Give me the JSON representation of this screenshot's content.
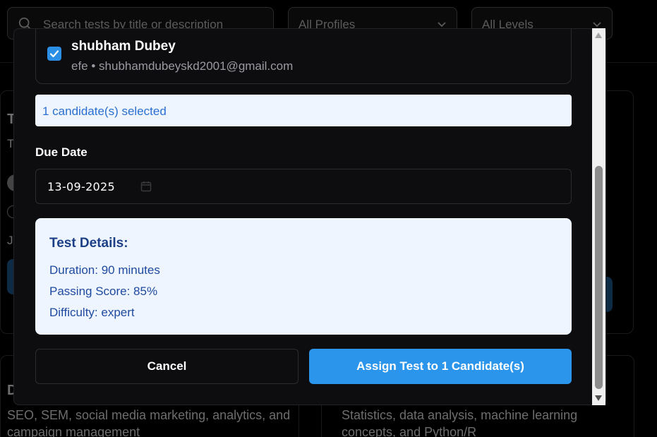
{
  "background": {
    "search_placeholder": "Search tests by title or description",
    "profile_filter": "All Profiles",
    "level_filter": "All Levels",
    "card_left_desc_line1": "SEO, SEM, social media marketing, analytics, and",
    "card_left_desc_line2": "campaign management",
    "card_right_desc_line1": "Statistics, data analysis, machine learning",
    "card_right_desc_line2": "concepts, and Python/R",
    "fragment_t1": "T",
    "fragment_t2": "T",
    "fragment_j": "J",
    "fragment_d": "D"
  },
  "modal": {
    "candidate": {
      "name": "shubham Dubey",
      "subtitle": "efe • shubhamdubeyskd2001@gmail.com",
      "checked": true
    },
    "selected_text": "1 candidate(s) selected",
    "due_date_label": "Due Date",
    "due_date_value": "13-09-2025",
    "details": {
      "title": "Test Details:",
      "duration": "Duration: 90 minutes",
      "passing_score": "Passing Score: 85%",
      "difficulty": "Difficulty: expert"
    },
    "cancel_label": "Cancel",
    "assign_label": "Assign Test to 1 Candidate(s)"
  },
  "colors": {
    "accent": "#2b95ec",
    "info_bg": "#eef5fe",
    "info_text": "#1f4aa0",
    "modal_bg": "#0d0d0f"
  },
  "icons": [
    "search-icon",
    "chevron-down-icon",
    "check-icon",
    "calendar-icon"
  ]
}
